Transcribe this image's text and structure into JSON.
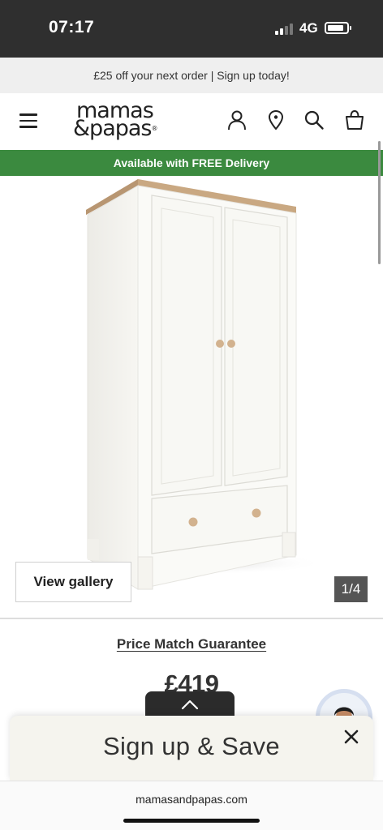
{
  "status_bar": {
    "time": "07:17",
    "network": "4G",
    "battery_level": 0.85
  },
  "promo": {
    "text": "£25 off your next order | Sign up today!"
  },
  "header": {
    "logo_line1": "mamas",
    "logo_line2": "&papas",
    "logo_mark": "®",
    "icons": [
      "menu-icon",
      "account-icon",
      "store-locator-icon",
      "search-icon",
      "basket-icon"
    ]
  },
  "delivery_banner": {
    "text": "Available with FREE Delivery",
    "color": "#3b8a3f"
  },
  "gallery": {
    "view_label": "View gallery",
    "counter": "1/4"
  },
  "product": {
    "price_match_label": "Price Match Guarantee",
    "price": "£419"
  },
  "signup": {
    "title": "Sign up & Save"
  },
  "browser": {
    "url": "mamasandpapas.com"
  }
}
